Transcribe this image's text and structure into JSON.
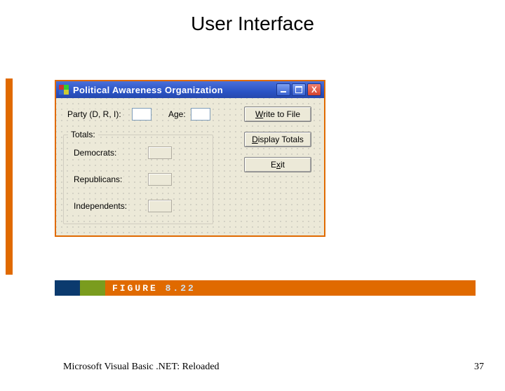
{
  "slide": {
    "title": "User Interface",
    "figure_label": "FIGURE",
    "figure_number": "8.22",
    "footer_text": "Microsoft Visual Basic .NET: Reloaded",
    "page_number": "37"
  },
  "window": {
    "title": "Political Awareness Organization",
    "labels": {
      "party": "Party (D, R, I):",
      "age": "Age:"
    },
    "inputs": {
      "party_value": "",
      "age_value": ""
    },
    "buttons": {
      "write_pre": "",
      "write_mn": "W",
      "write_post": "rite to File",
      "display_pre": "",
      "display_mn": "D",
      "display_post": "isplay Totals",
      "exit_pre": "E",
      "exit_mn": "x",
      "exit_post": "it"
    },
    "group": {
      "legend": "Totals:",
      "rows": {
        "democrats": "Democrats:",
        "republicans": "Republicans:",
        "independents": "Independents:",
        "democrats_value": "",
        "republicans_value": "",
        "independents_value": ""
      }
    }
  }
}
